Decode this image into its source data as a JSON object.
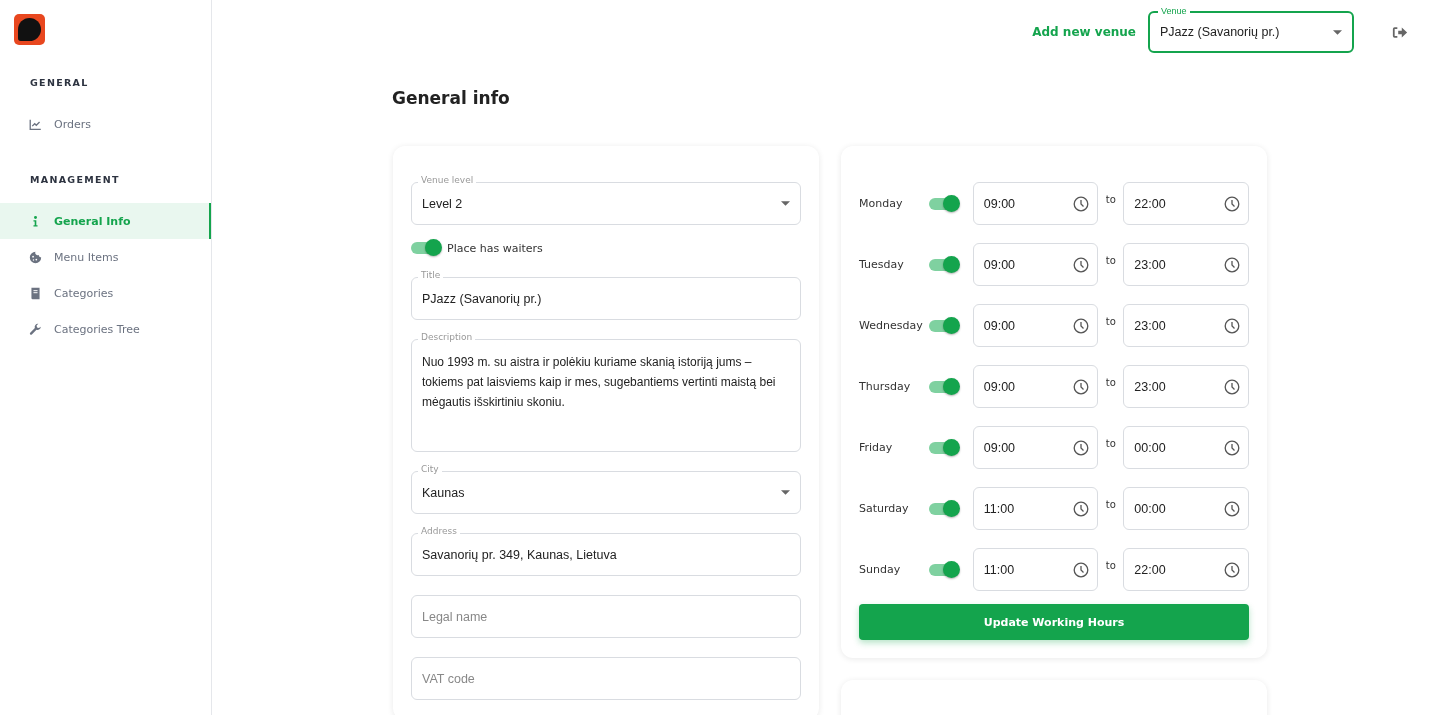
{
  "sidebar": {
    "sections": [
      {
        "heading": "GENERAL",
        "items": [
          {
            "label": "Orders",
            "selected": false
          }
        ]
      },
      {
        "heading": "MANAGEMENT",
        "items": [
          {
            "label": "General Info",
            "selected": true
          },
          {
            "label": "Menu Items",
            "selected": false
          },
          {
            "label": "Categories",
            "selected": false
          },
          {
            "label": "Categories Tree",
            "selected": false
          }
        ]
      }
    ]
  },
  "topbar": {
    "add_venue": "Add new venue",
    "venue_select": {
      "label": "Venue",
      "value": "PJazz (Savanorių pr.)"
    }
  },
  "page_title": "General info",
  "general_form": {
    "fields": [
      {
        "kind": "select",
        "label": "Venue level",
        "value": "Level 2"
      },
      {
        "kind": "toggle",
        "label": "Place has waiters",
        "on": true
      },
      {
        "kind": "text",
        "label": "Title",
        "value": "PJazz (Savanorių pr.)"
      },
      {
        "kind": "textarea",
        "label": "Description",
        "value": "Nuo 1993 m. su aistra ir polėkiu kuriame skanią istoriją jums – tokiems pat laisviems kaip ir mes, sugebantiems vertinti maistą bei mėgautis išskirtiniu skoniu."
      },
      {
        "kind": "select",
        "label": "City",
        "value": "Kaunas"
      },
      {
        "kind": "text",
        "label": "Address",
        "value": "Savanorių pr. 349, Kaunas, Lietuva"
      },
      {
        "kind": "text",
        "placeholder": "Legal name"
      },
      {
        "kind": "text",
        "placeholder": "VAT code"
      }
    ]
  },
  "working_hours": {
    "days": [
      {
        "day": "Monday",
        "on": true,
        "from": "09:00",
        "separator": "to",
        "to": "22:00"
      },
      {
        "day": "Tuesday",
        "on": true,
        "from": "09:00",
        "separator": "to",
        "to": "23:00"
      },
      {
        "day": "Wednesday",
        "on": true,
        "from": "09:00",
        "separator": "to",
        "to": "23:00"
      },
      {
        "day": "Thursday",
        "on": true,
        "from": "09:00",
        "separator": "to",
        "to": "23:00"
      },
      {
        "day": "Friday",
        "on": true,
        "from": "09:00",
        "separator": "to",
        "to": "00:00"
      },
      {
        "day": "Saturday",
        "on": true,
        "from": "11:00",
        "separator": "to",
        "to": "00:00"
      },
      {
        "day": "Sunday",
        "on": true,
        "from": "11:00",
        "separator": "to",
        "to": "22:00"
      }
    ],
    "button": "Update Working Hours"
  }
}
